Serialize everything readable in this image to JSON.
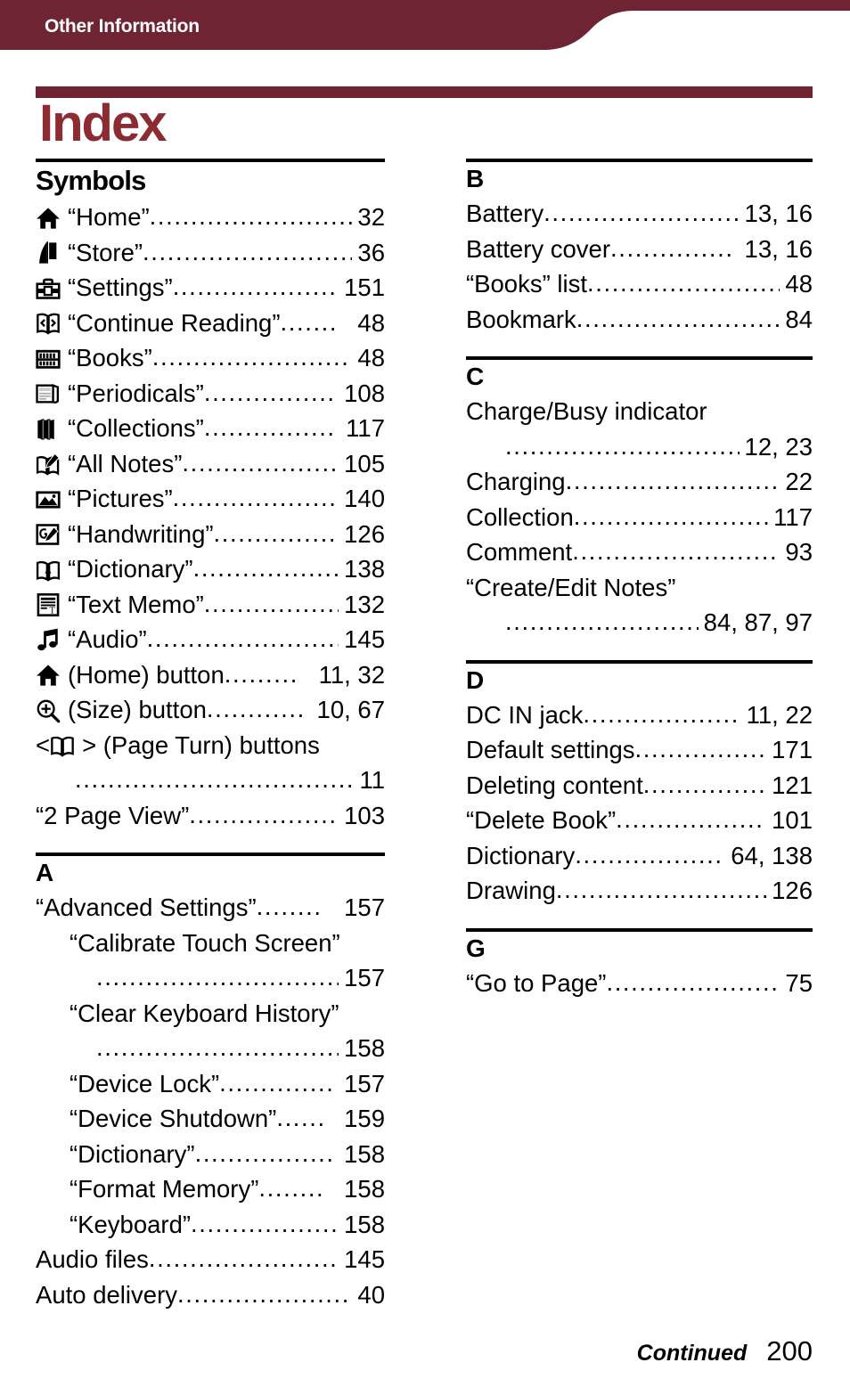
{
  "header": {
    "breadcrumb": "Other Information",
    "bar_color": "#6e2433"
  },
  "page_title": "Index",
  "title_color": "#8c2b32",
  "columns": {
    "left": [
      {
        "letter": "Symbols",
        "style": "symbols",
        "entries": [
          {
            "icon": "home-icon",
            "label": "“Home”",
            "dots": "..........................",
            "page": "32"
          },
          {
            "icon": "store-icon",
            "label": "“Store”",
            "dots": ".............................",
            "page": "36"
          },
          {
            "icon": "settings-toolbox-icon",
            "label": "“Settings”",
            "dots": "......................",
            "page": "151"
          },
          {
            "icon": "continue-reading-icon",
            "label": "“Continue Reading”",
            "dots": ".......",
            "page": "48"
          },
          {
            "icon": "books-icon",
            "label": "“Books”",
            "dots": "...........................",
            "page": "48"
          },
          {
            "icon": "periodicals-icon",
            "label": "“Periodicals”",
            "dots": "................",
            "page": "108"
          },
          {
            "icon": "collections-icon",
            "label": "“Collections”",
            "dots": "................",
            "page": "117"
          },
          {
            "icon": "all-notes-icon",
            "label": "“All Notes”",
            "dots": "....................",
            "page": "105"
          },
          {
            "icon": "pictures-icon",
            "label": "“Pictures”",
            "dots": "......................",
            "page": "140"
          },
          {
            "icon": "handwriting-icon",
            "label": "“Handwriting”",
            "dots": "................",
            "page": "126"
          },
          {
            "icon": "dictionary-icon",
            "label": "“Dictionary”",
            "dots": "...................",
            "page": "138"
          },
          {
            "icon": "text-memo-icon",
            "label": "“Text Memo”",
            "dots": ".................",
            "page": "132"
          },
          {
            "icon": "audio-icon",
            "label": "“Audio”",
            "dots": "..........................",
            "page": "145"
          },
          {
            "icon": "home-icon",
            "label": "(Home) button",
            "dots": ".........",
            "page": "11, 32"
          },
          {
            "icon": "size-icon",
            "label": "(Size) button",
            "dots": "............",
            "page": "10, 67"
          },
          {
            "icon": "page-turn-icon",
            "wrap": true,
            "label_pre": "< ",
            "label_post": " > (Page Turn) buttons",
            "dots": ".......................................",
            "page": "11"
          },
          {
            "icon": null,
            "label": "“2 Page View”",
            "dots": "..................",
            "page": "103"
          }
        ]
      },
      {
        "letter": "A",
        "style": "normal",
        "entries": [
          {
            "icon": null,
            "label": "“Advanced Settings”",
            "dots": "........",
            "page": "157"
          },
          {
            "icon": null,
            "indent": "sub",
            "label": "“Calibrate Touch Screen”",
            "nodots": true
          },
          {
            "icon": null,
            "indent": "sub-cont",
            "label": "",
            "dots": "................................",
            "page": "157"
          },
          {
            "icon": null,
            "indent": "sub",
            "label": "“Clear Keyboard History”",
            "nodots": true
          },
          {
            "icon": null,
            "indent": "sub-cont",
            "label": "",
            "dots": "................................",
            "page": "158"
          },
          {
            "icon": null,
            "indent": "sub",
            "label": "“Device Lock”",
            "dots": "..............",
            "page": "157"
          },
          {
            "icon": null,
            "indent": "sub",
            "label": "“Device Shutdown”",
            "dots": "......",
            "page": "159"
          },
          {
            "icon": null,
            "indent": "sub",
            "label": "“Dictionary”",
            "dots": ".................",
            "page": "158"
          },
          {
            "icon": null,
            "indent": "sub",
            "label": "“Format Memory”",
            "dots": "........",
            "page": "158"
          },
          {
            "icon": null,
            "indent": "sub",
            "label": "“Keyboard”",
            "dots": "...................",
            "page": "158"
          },
          {
            "icon": null,
            "label": "Audio files",
            "dots": "........................",
            "page": "145"
          },
          {
            "icon": null,
            "label": "Auto delivery",
            "dots": ".......................",
            "page": "40"
          }
        ]
      }
    ],
    "right": [
      {
        "letter": "B",
        "style": "normal",
        "entries": [
          {
            "icon": null,
            "label": "Battery",
            "dots": ".........................",
            "page": "13, 16"
          },
          {
            "icon": null,
            "label": "Battery cover",
            "dots": "...............",
            "page": "13, 16"
          },
          {
            "icon": null,
            "label": "“Books” list",
            "dots": ".........................",
            "page": "48"
          },
          {
            "icon": null,
            "label": "Bookmark",
            "dots": "..........................",
            "page": "84"
          }
        ]
      },
      {
        "letter": "C",
        "style": "normal",
        "entries": [
          {
            "icon": null,
            "label": "Charge/Busy indicator",
            "nodots": true
          },
          {
            "icon": null,
            "indent": "cont",
            "label": "",
            "dots": "................................",
            "page": "12, 23"
          },
          {
            "icon": null,
            "label": "Charging",
            "dots": "............................",
            "page": "22"
          },
          {
            "icon": null,
            "label": "Collection",
            "dots": "..........................",
            "page": "117"
          },
          {
            "icon": null,
            "label": "Comment",
            "dots": "...........................",
            "page": "93"
          },
          {
            "icon": null,
            "label": "“Create/Edit Notes”",
            "nodots": true
          },
          {
            "icon": null,
            "indent": "cont",
            "label": "",
            "dots": "..........................",
            "page": "84, 87, 97"
          }
        ]
      },
      {
        "letter": "D",
        "style": "normal",
        "entries": [
          {
            "icon": null,
            "label": "DC IN jack",
            "dots": "...................",
            "page": "11, 22"
          },
          {
            "icon": null,
            "label": "Default settings",
            "dots": "................",
            "page": "171"
          },
          {
            "icon": null,
            "label": "Deleting content",
            "dots": "...............",
            "page": "121"
          },
          {
            "icon": null,
            "label": "“Delete Book”",
            "dots": "...................",
            "page": "101"
          },
          {
            "icon": null,
            "label": "Dictionary",
            "dots": "..................",
            "page": "64, 138"
          },
          {
            "icon": null,
            "label": "Drawing",
            "dots": "...........................",
            "page": "126"
          }
        ]
      },
      {
        "letter": "G",
        "style": "normal",
        "entries": [
          {
            "icon": null,
            "label": "“Go to Page”",
            "dots": "......................",
            "page": "75"
          }
        ]
      }
    ]
  },
  "footer": {
    "continued_label": "Continued",
    "page_number": "200"
  }
}
